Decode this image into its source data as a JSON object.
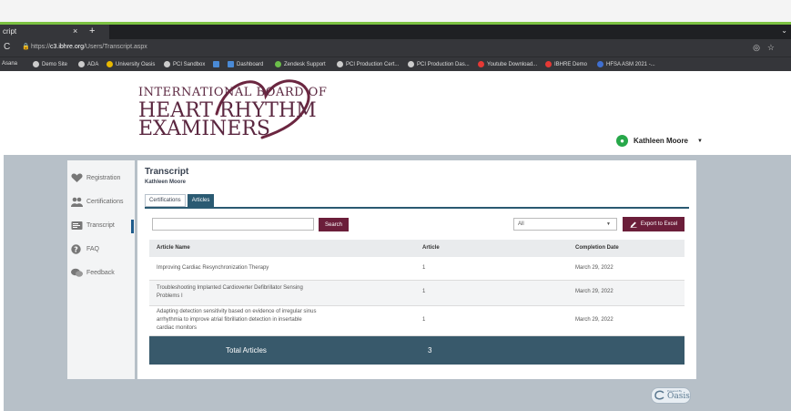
{
  "browser": {
    "tab_title": "cript",
    "tab_close": "×",
    "tab_new": "+",
    "url_scheme": "https://",
    "url_host": "c3.ibhre.org",
    "url_path": "/Users/Transcript.aspx",
    "bookmarks": [
      "Asana",
      "Demo Site",
      "ADA",
      "University Oasis",
      "PCI Sandbox",
      "",
      "Dashboard",
      "Zendesk Support",
      "PCI Production Cert...",
      "PCI Production Das...",
      "Youtube Download...",
      "IBHRE Demo",
      "HFSA ASM 2021 -..."
    ]
  },
  "logo": {
    "line1": "INTERNATIONAL BOARD OF",
    "line2": "HEART RHYTHM",
    "line3": "EXAMINERS"
  },
  "user": {
    "name": "Kathleen Moore"
  },
  "nav": [
    {
      "label": "Registration",
      "icon": "heart-pulse-icon"
    },
    {
      "label": "Certifications",
      "icon": "users-icon"
    },
    {
      "label": "Transcript",
      "icon": "transcript-icon",
      "active": true
    },
    {
      "label": "FAQ",
      "icon": "question-icon"
    },
    {
      "label": "Feedback",
      "icon": "comments-icon"
    }
  ],
  "page": {
    "title": "Transcript",
    "subtitle": "Kathleen Moore",
    "tabs": [
      {
        "label": "Certifications"
      },
      {
        "label": "Articles",
        "active": true
      }
    ],
    "search_value": "",
    "search_label": "Search",
    "filter_value": "All",
    "export_label": "Export to Excel"
  },
  "table": {
    "headers": [
      "Article Name",
      "Article",
      "Completion Date"
    ],
    "rows": [
      {
        "name": [
          "Improving Cardiac Resynchronization Therapy"
        ],
        "article": "1",
        "date": "March 29, 2022"
      },
      {
        "name": [
          "Troubleshooting Implanted Cardioverter Defibrillator Sensing",
          "Problems I"
        ],
        "article": "1",
        "date": "March 29, 2022"
      },
      {
        "name": [
          "Adapting detection sensitivity based on evidence of irregular sinus",
          "arrhythmia to improve atrial fibrillation detection in insertable",
          "cardiac monitors"
        ],
        "article": "1",
        "date": "March 29, 2022"
      }
    ],
    "total_label": "Total Articles",
    "total_value": "3"
  },
  "footer": {
    "powered_small": "Powered By",
    "powered_brand": "Oasis"
  },
  "colors": {
    "brand": "#5b2740",
    "accent": "#6b1e3a",
    "teal": "#38596b",
    "green": "#7cc242"
  }
}
